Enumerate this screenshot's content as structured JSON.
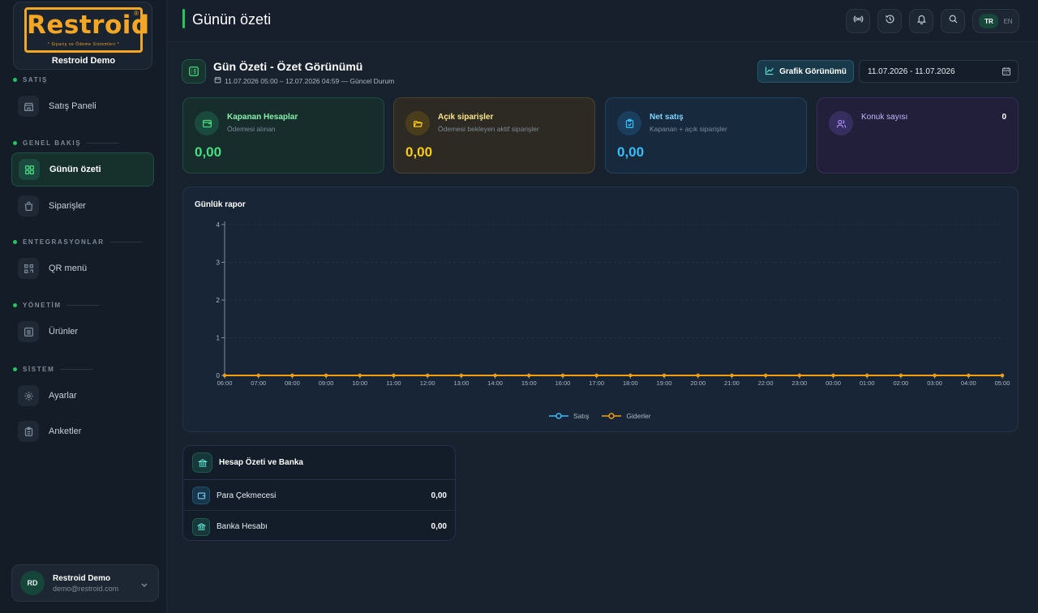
{
  "brand": {
    "logo_text": "Restroid",
    "logo_registered": "®",
    "tagline": "* Sipariş ve Ödeme Sistemleri *",
    "company": "Restroid Demo"
  },
  "sidebar": {
    "sections": [
      {
        "title": "SATIŞ",
        "items": [
          {
            "label": "Satış Paneli",
            "icon": "store-icon"
          }
        ]
      },
      {
        "title": "GENEL BAKIŞ",
        "items": [
          {
            "label": "Günün özeti",
            "icon": "grid-icon",
            "active": true
          },
          {
            "label": "Siparişler",
            "icon": "bag-icon"
          }
        ]
      },
      {
        "title": "ENTEGRASYONLAR",
        "items": [
          {
            "label": "QR menü",
            "icon": "qr-icon"
          }
        ]
      },
      {
        "title": "YÖNETİM",
        "items": [
          {
            "label": "Ürünler",
            "icon": "list-icon"
          }
        ]
      },
      {
        "title": "SİSTEM",
        "items": [
          {
            "label": "Ayarlar",
            "icon": "gear-icon"
          },
          {
            "label": "Anketler",
            "icon": "clipboard-icon"
          }
        ]
      }
    ],
    "user": {
      "initials": "RD",
      "name": "Restroid Demo",
      "email": "demo@restroid.com"
    }
  },
  "header": {
    "title": "Günün özeti",
    "buttons": [
      "broadcast-icon",
      "history-icon",
      "bell-icon",
      "search-icon"
    ],
    "lang_active": "TR",
    "lang_other": "EN"
  },
  "summary": {
    "title": "Gün Özeti - Özet Görünümü",
    "subtitle": "11.07.2026 05:00 – 12.07.2026 04:59 — Güncel Durum",
    "chart_view_label": "Grafik Görünümü",
    "date_range": "11.07.2026 - 11.07.2026"
  },
  "stats": [
    {
      "title": "Kapanan Hesaplar",
      "sub": "Ödemesi alınan",
      "value": "0,00",
      "color": "#4ade80"
    },
    {
      "title": "Açık siparişler",
      "sub": "Ödemesi bekleyen aktif siparişler",
      "value": "0,00",
      "color": "#facc15"
    },
    {
      "title": "Net satış",
      "sub": "Kapanan + açık siparişler",
      "value": "0,00",
      "color": "#38bdf8"
    },
    {
      "title": "Konuk sayısı",
      "sub": "",
      "value": "0",
      "color": "#a78bfa"
    }
  ],
  "chart_data": {
    "type": "line",
    "title": "Günlük rapor",
    "x": [
      "06:00",
      "07:00",
      "08:00",
      "09:00",
      "10:00",
      "11:00",
      "12:00",
      "13:00",
      "14:00",
      "15:00",
      "16:00",
      "17:00",
      "18:00",
      "19:00",
      "20:00",
      "21:00",
      "22:00",
      "23:00",
      "00:00",
      "01:00",
      "02:00",
      "03:00",
      "04:00",
      "05:00"
    ],
    "ylim": [
      0,
      4
    ],
    "yticks": [
      0,
      1,
      2,
      3,
      4
    ],
    "series": [
      {
        "name": "Satış",
        "color": "#38bdf8",
        "values": [
          0,
          0,
          0,
          0,
          0,
          0,
          0,
          0,
          0,
          0,
          0,
          0,
          0,
          0,
          0,
          0,
          0,
          0,
          0,
          0,
          0,
          0,
          0,
          0
        ]
      },
      {
        "name": "Giderler",
        "color": "#f59e0b",
        "values": [
          0,
          0,
          0,
          0,
          0,
          0,
          0,
          0,
          0,
          0,
          0,
          0,
          0,
          0,
          0,
          0,
          0,
          0,
          0,
          0,
          0,
          0,
          0,
          0
        ]
      }
    ],
    "legend": "bottom",
    "grid": true
  },
  "bank": {
    "title": "Hesap Özeti ve Banka",
    "rows": [
      {
        "label": "Para Çekmecesi",
        "value": "0,00"
      },
      {
        "label": "Banka Hesabı",
        "value": "0,00"
      }
    ]
  }
}
